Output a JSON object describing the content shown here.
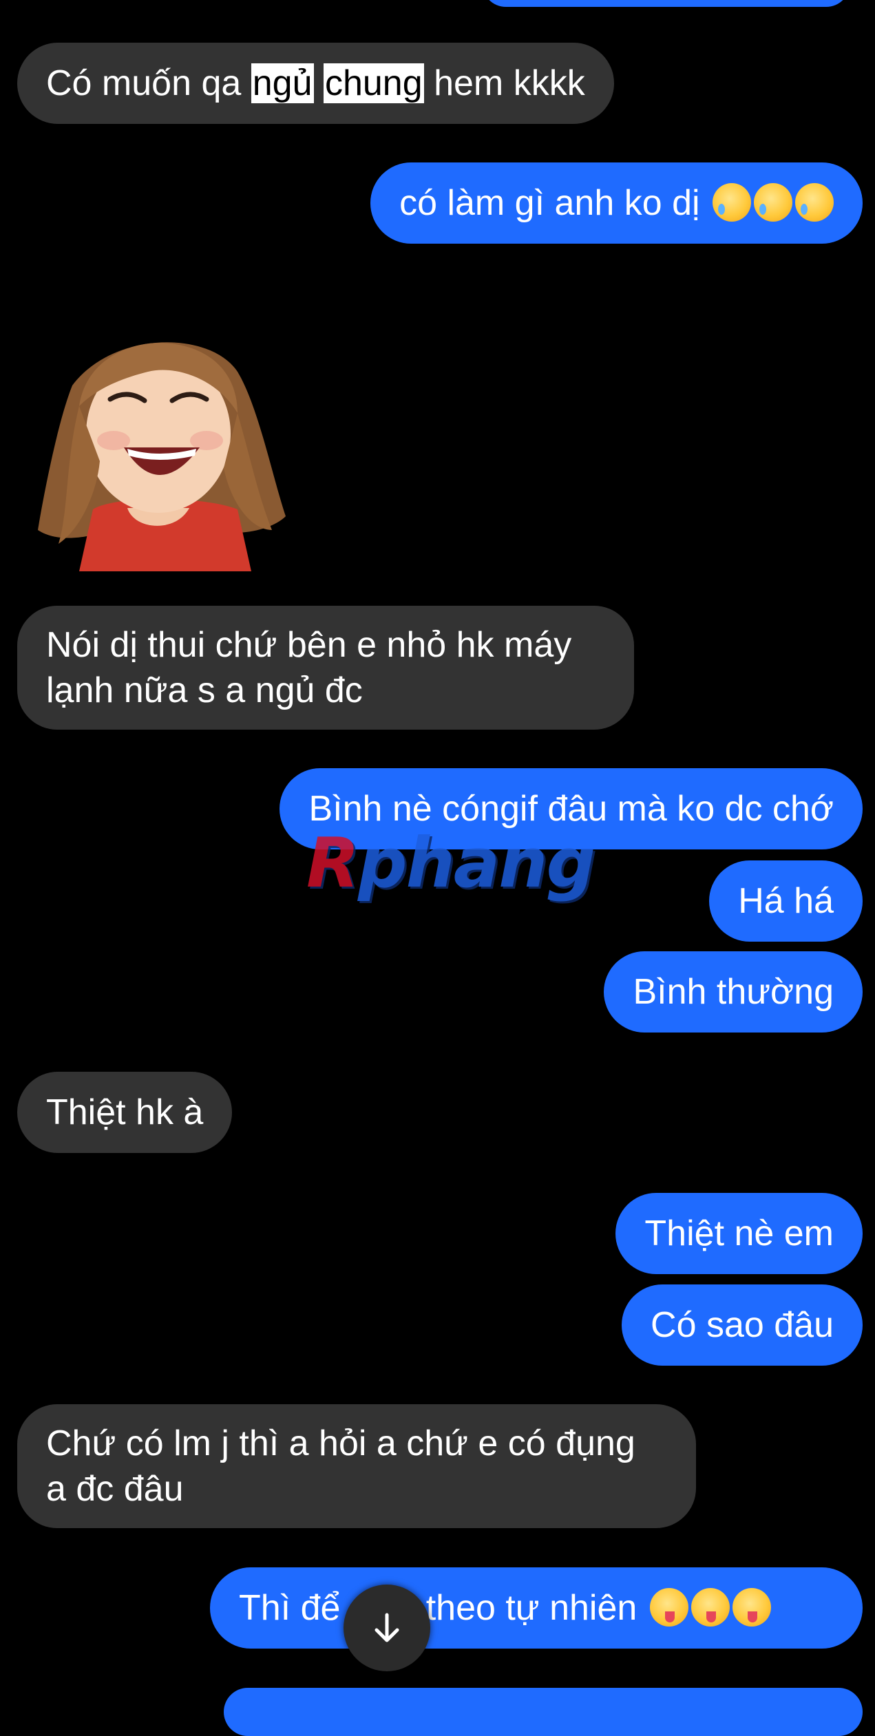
{
  "messages": [
    {
      "from": "them",
      "parts": [
        "Có muốn qa ",
        "ngủ",
        " ",
        "chung",
        " hem kkkk"
      ]
    },
    {
      "from": "me",
      "text": "có làm gì anh ko dị",
      "emoji": "face-holding-back-tears x3"
    },
    {
      "from": "them",
      "line1": "Nói dị thui chứ bên e nhỏ hk máy",
      "line2": "lạnh nữa s a ngủ đc"
    },
    {
      "from": "me",
      "text": "Bình nè cóngif đâu mà ko dc chớ"
    },
    {
      "from": "me",
      "text": "Há há"
    },
    {
      "from": "me",
      "text": "Bình thường"
    },
    {
      "from": "them",
      "text": "Thiệt hk à"
    },
    {
      "from": "me",
      "text": "Thiệt nè em"
    },
    {
      "from": "me",
      "text": "Có sao đâu"
    },
    {
      "from": "them",
      "line1": "Chứ có lm j thì a hỏi a chứ e có đụng",
      "line2": "a đc đâu"
    },
    {
      "from": "me",
      "before": "Thì để",
      "after": "ên theo tự nhiên",
      "emoji": "squinting-face-with-tongue x3"
    }
  ],
  "sticker": "laughing-avatar-sticker",
  "watermark": {
    "part1": "R",
    "part2": "phang"
  },
  "colors": {
    "background": "#000000",
    "incoming_bubble": "#333333",
    "outgoing_bubble": "#1f6bff",
    "text": "#ffffff"
  },
  "icons": {
    "scroll_down": "arrow-down-icon"
  }
}
